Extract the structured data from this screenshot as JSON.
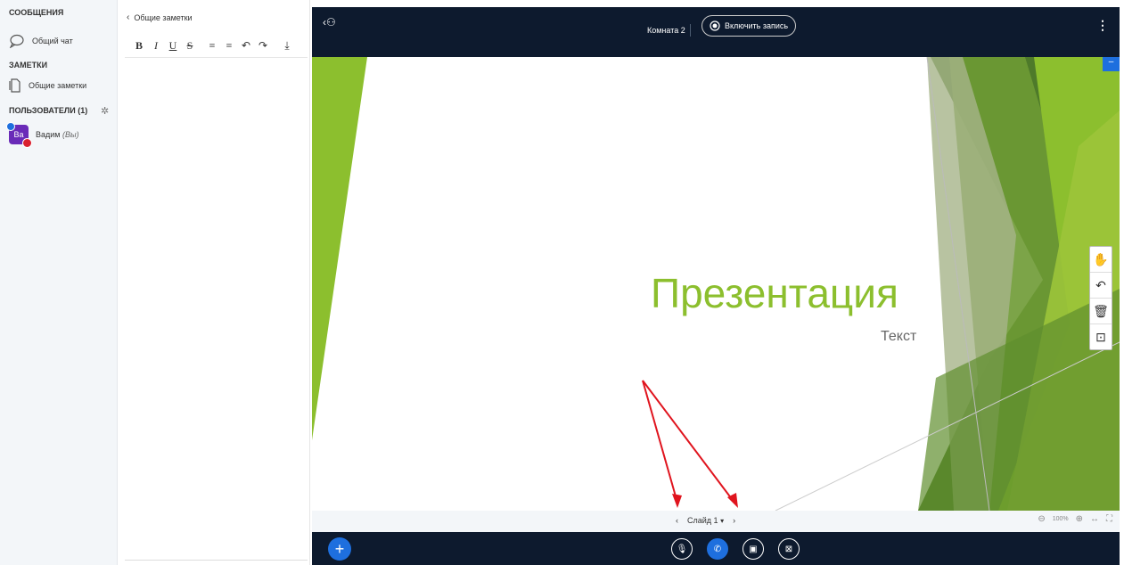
{
  "sidebar": {
    "messages_title": "СООБЩЕНИЯ",
    "chat_label": "Общий чат",
    "notes_title": "ЗАМЕТКИ",
    "notes_label": "Общие заметки",
    "users_title": "ПОЛЬЗОВАТЕЛИ (1)",
    "user_avatar": "Ва",
    "user_name": "Вадим",
    "user_you": "(Вы)"
  },
  "notes_panel": {
    "header": "Общие заметки",
    "toolbar": [
      "B",
      "I",
      "U",
      "S",
      "≡",
      "≡",
      "↶",
      "↷",
      "⤓"
    ]
  },
  "topbar": {
    "room": "Комната 2",
    "record_label": "Включить запись"
  },
  "slide": {
    "title": "Презентация",
    "subtitle": "Текст"
  },
  "slide_nav": {
    "slide_label": "Слайд 1",
    "zoom": "100%"
  },
  "colors": {
    "accent": "#1e6fde",
    "dark": "#0d1a2e",
    "slide_green": "#8cbf2e"
  }
}
